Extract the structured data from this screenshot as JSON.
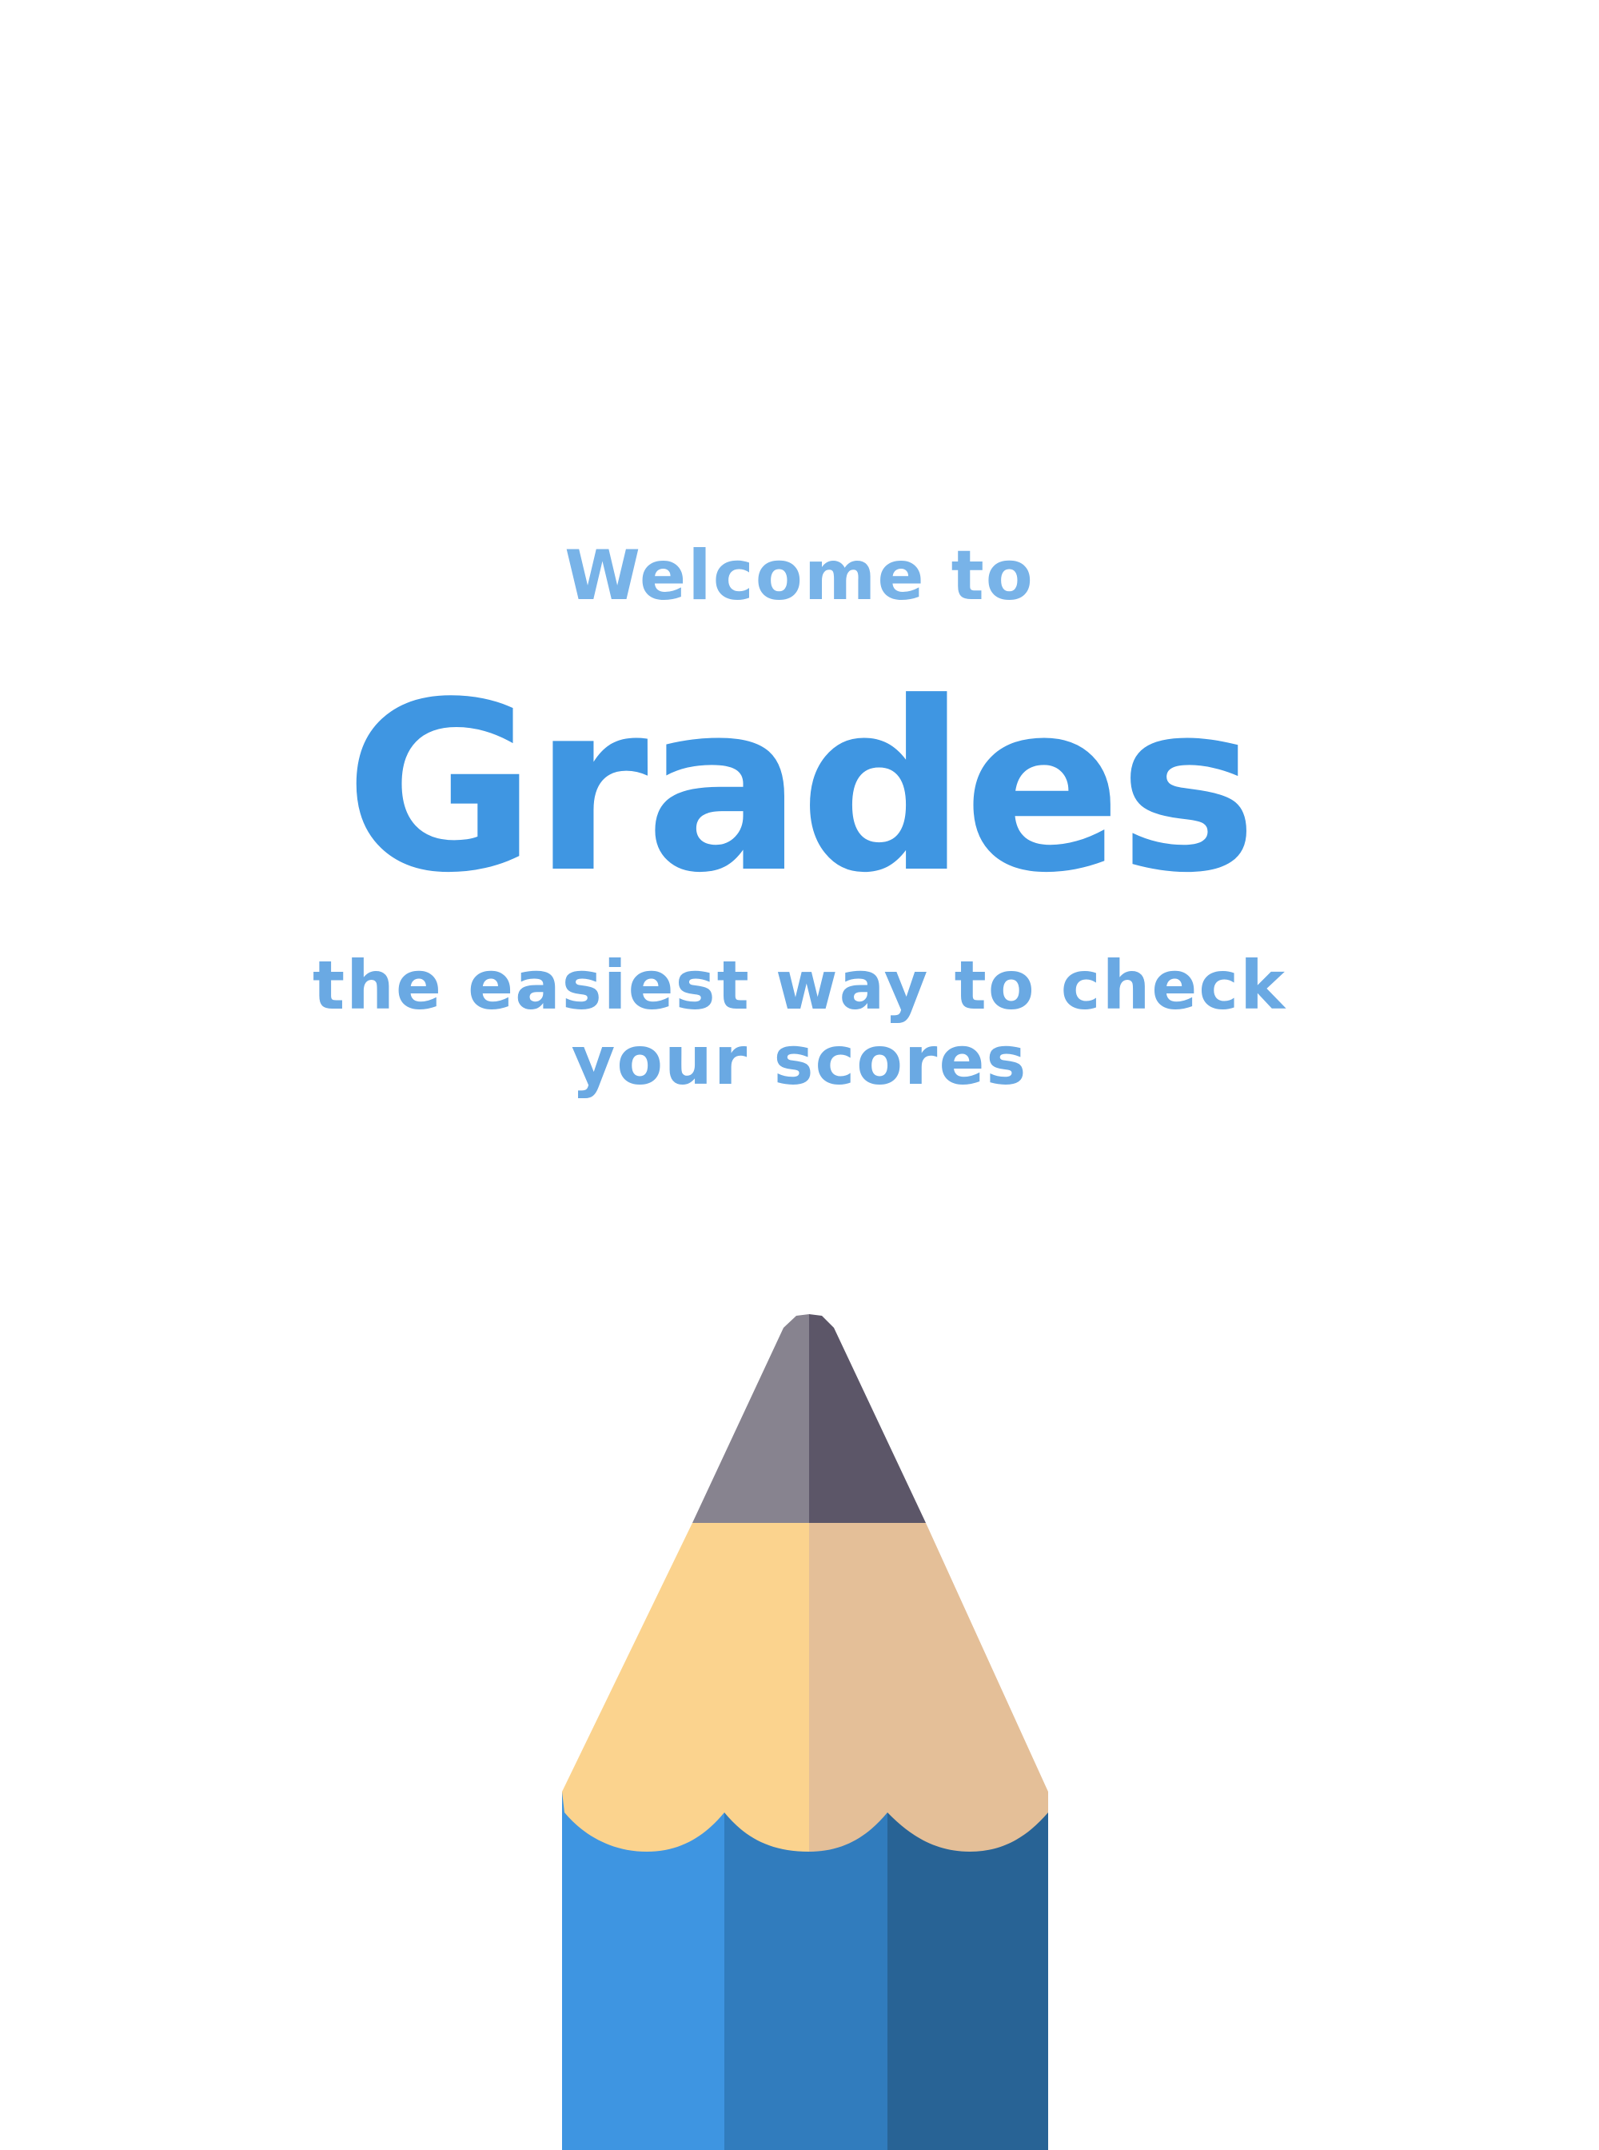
{
  "app": {
    "welcome_text": "Welcome to",
    "title": "Grades",
    "tagline_line1": "the easiest way to check",
    "tagline_line2": "your scores"
  },
  "illustration": {
    "icon": "pencil-icon",
    "colors": {
      "tip_light": "#87838f",
      "tip_dark": "#5c5668",
      "wood_light": "#fbd38e",
      "wood_dark": "#e4bf98",
      "body_left": "#3e95e1",
      "body_mid": "#317cbd",
      "body_right": "#286395"
    }
  },
  "theme": {
    "title_color": "#3f96e2",
    "subtitle_color": "#6aa9e3",
    "background": "#ffffff"
  }
}
